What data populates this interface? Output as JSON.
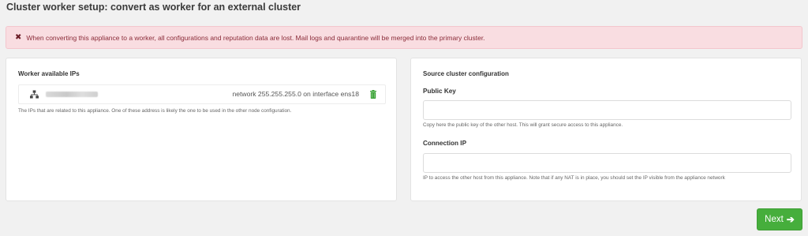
{
  "page": {
    "title": "Cluster worker setup: convert as worker for an external cluster"
  },
  "alert": {
    "icon": "close-icon",
    "message": "When converting this appliance to a worker, all configurations and reputation data are lost. Mail logs and quarantine will be merged into the primary cluster."
  },
  "worker_ips": {
    "title": "Worker available IPs",
    "items": [
      {
        "icon": "network-icon",
        "description": "network 255.255.255.0 on interface ens18",
        "action_icon": "trash-icon"
      }
    ],
    "help": "The IPs that are related to this appliance. One of these address is likely the one to be used in the other node configuration."
  },
  "source_cluster": {
    "title": "Source cluster configuration",
    "public_key": {
      "label": "Public Key",
      "value": "",
      "help": "Copy here the public key of the other host. This will grant secure access to this appliance."
    },
    "connection_ip": {
      "label": "Connection IP",
      "value": "",
      "help": "IP to access the other host from this appliance. Note that if any NAT is in place, you should set the IP visible from the appliance network"
    }
  },
  "actions": {
    "next_label": "Next",
    "next_icon": "arrow-right-icon"
  },
  "colors": {
    "alert_bg": "#f9dde1",
    "alert_text": "#8a2b38",
    "primary_green": "#46ae3c",
    "trash_green": "#3aa336"
  }
}
